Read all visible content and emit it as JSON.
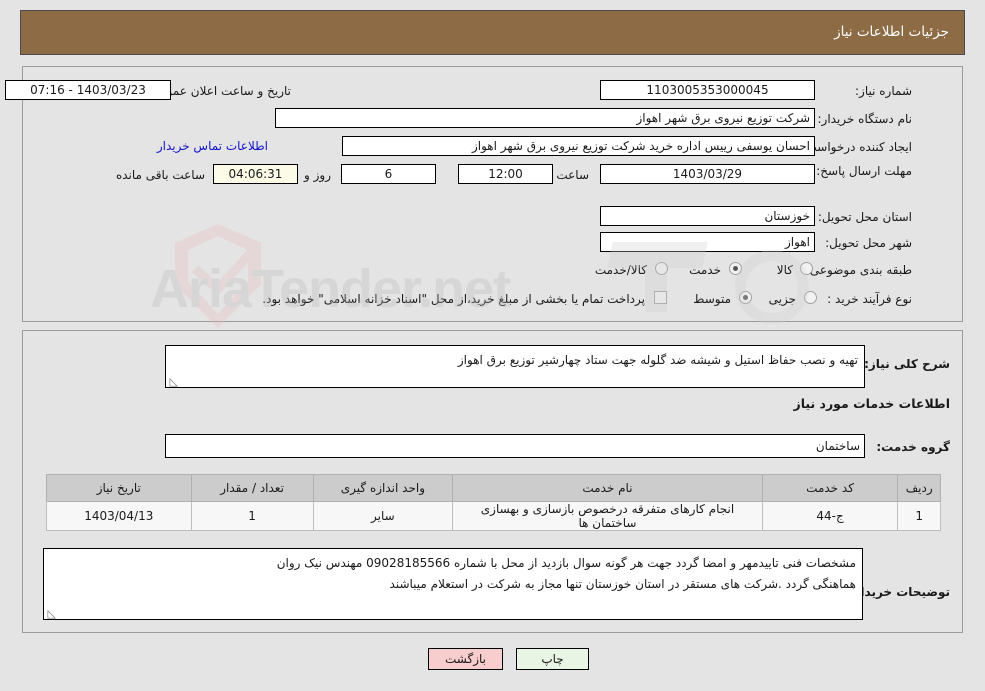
{
  "header": {
    "title": "جزئیات اطلاعات نیاز"
  },
  "watermark": {
    "text": "AriaTender.net"
  },
  "form": {
    "need_number_label": "شماره نیاز:",
    "need_number_value": "1103005353000045",
    "announce_label": "تاریخ و ساعت اعلان عمومی:",
    "announce_value": "1403/03/23 - 07:16",
    "buyer_org_label": "نام دستگاه خریدار:",
    "buyer_org_value": "شرکت توزیع نیروی برق شهر اهواز",
    "creator_label": "ایجاد کننده درخواست:",
    "creator_value": "احسان یوسفی رییس اداره خرید شرکت توزیع نیروی برق شهر اهواز",
    "contact_link": "اطلاعات تماس خریدار",
    "deadline_label": "مهلت ارسال پاسخ: تا تاریخ:",
    "deadline_value": "1403/03/29",
    "hour_label": "ساعت",
    "hour_value": "12:00",
    "days_value": "6",
    "days_and_label": "روز و",
    "remaining_value": "04:06:31",
    "remaining_label": "ساعت باقی مانده",
    "province_label": "استان محل تحویل:",
    "province_value": "خوزستان",
    "city_label": "شهر محل تحویل:",
    "city_value": "اهواز",
    "category_label": "طبقه بندی موضوعی:",
    "category_options": [
      {
        "label": "کالا",
        "selected": false
      },
      {
        "label": "خدمت",
        "selected": true
      },
      {
        "label": "کالا/خدمت",
        "selected": false
      }
    ],
    "purchase_type_label": "نوع فرآیند خرید :",
    "purchase_type_options": [
      {
        "label": "جزیی",
        "selected": false
      },
      {
        "label": "متوسط",
        "selected": true
      }
    ],
    "treasury_checkbox_label": "پرداخت تمام یا بخشی از مبلغ خرید،از محل \"اسناد خزانه اسلامی\" خواهد بود.",
    "treasury_checked": false
  },
  "need_summary": {
    "label": "شرح کلی نیاز:",
    "value": "تهیه و نصب حفاظ استیل و شیشه ضد گلوله جهت ستاد چهارشیر توزیع برق اهواز"
  },
  "services_section": {
    "heading": "اطلاعات خدمات مورد نیاز",
    "group_label": "گروه خدمت:",
    "group_value": "ساختمان"
  },
  "table": {
    "columns": [
      "ردیف",
      "کد خدمت",
      "نام خدمت",
      "واحد اندازه گیری",
      "تعداد / مقدار",
      "تاریخ نیاز"
    ],
    "rows": [
      {
        "row": "1",
        "code": "ج-44",
        "name": "انجام کارهای متفرقه درخصوص بازسازی و بهسازی ساختمان ها",
        "unit": "سایر",
        "qty": "1",
        "date": "1403/04/13"
      }
    ]
  },
  "buyer_notes": {
    "label": "توضیحات خریدار:",
    "line1": "مشخصات فنی تاییدمهر و امضا گردد جهت هر گونه سوال بازدید از محل با شماره 09028185566 مهندس نیک روان",
    "line2": "هماهنگی گردد .شرکت های مستقر در استان خوزستان تنها مجاز به شرکت در استعلام میباشند"
  },
  "buttons": {
    "print": "چاپ",
    "back": "بازگشت"
  }
}
